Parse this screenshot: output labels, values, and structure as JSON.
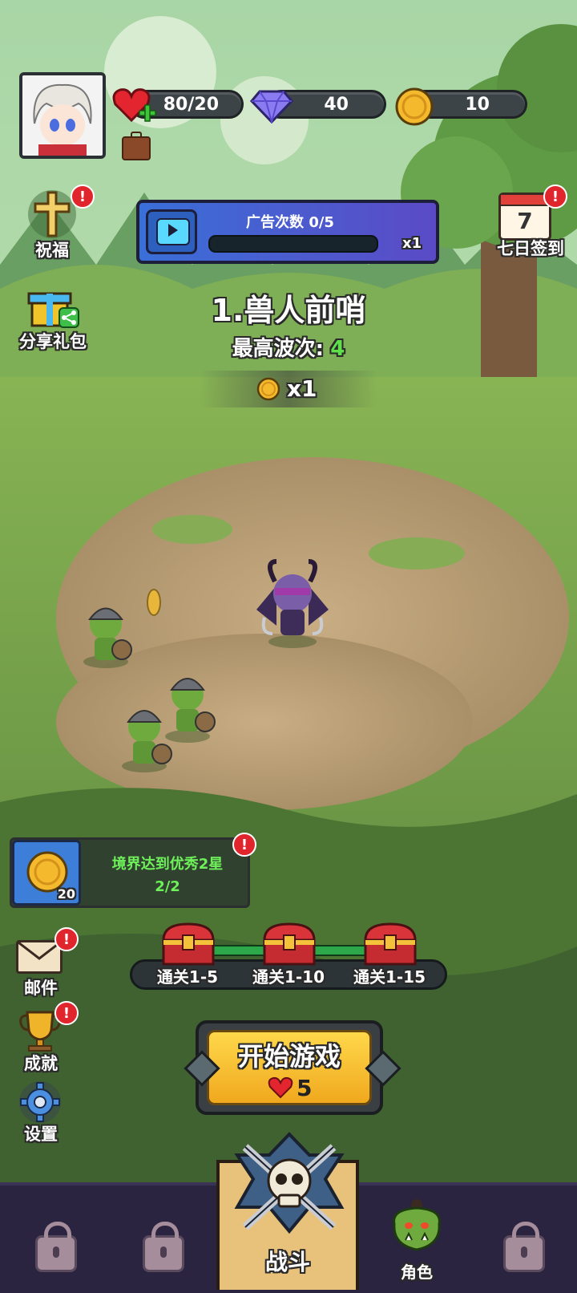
{
  "stats": {
    "hearts": "80/20",
    "gems": "40",
    "coins": "10"
  },
  "left_menu": {
    "blessing": "祝福",
    "share_gift": "分享礼包",
    "mail": "邮件",
    "achievement": "成就",
    "settings": "设置"
  },
  "right_menu": {
    "checkin": "七日签到",
    "calendar_day": "7"
  },
  "ad_panel": {
    "label": "广告次数 0/5",
    "multiplier": "x1",
    "progress": 0
  },
  "stage": {
    "title": "1.兽人前哨",
    "best_wave_label": "最高波次:",
    "best_wave_value": "4",
    "coin_reward": "x1"
  },
  "quest": {
    "title": "境界达到优秀2星",
    "progress": "2/2",
    "reward": "20"
  },
  "chests": [
    {
      "label": "通关1-5"
    },
    {
      "label": "通关1-10"
    },
    {
      "label": "通关1-15"
    }
  ],
  "start": {
    "label": "开始游戏",
    "cost": "5"
  },
  "nav": {
    "battle": "战斗",
    "character": "角色"
  },
  "badge_mark": "!",
  "colors": {
    "accent_yellow": "#f5c028",
    "badge_red": "#e0262c",
    "ad_panel_blue": "#4a52c8",
    "nav_bg": "#2a2440"
  }
}
